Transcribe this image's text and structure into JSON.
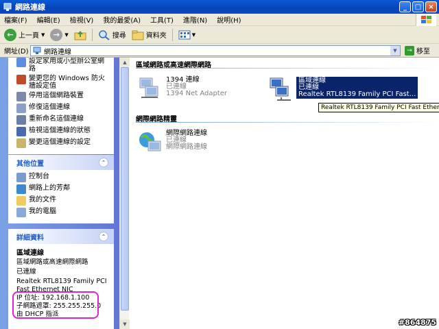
{
  "window": {
    "title": "網路連線"
  },
  "menu": [
    "檔案(F)",
    "編輯(E)",
    "檢視(V)",
    "我的最愛(A)",
    "工具(T)",
    "進階(N)",
    "說明(H)"
  ],
  "toolbar": {
    "back_label": "上一頁",
    "search_label": "搜尋",
    "folders_label": "資料夾"
  },
  "address": {
    "label": "網址(D)",
    "value": "網路連線",
    "go_label": "移至"
  },
  "tasks": [
    "設定家用或小型辦公室網路",
    "變更您的 Windows 防火牆設定值",
    "停用這個網路裝置",
    "修復這個連線",
    "重新命名這個連線",
    "檢視這個連線的狀態",
    "變更這個連線的設定"
  ],
  "other_places": {
    "title": "其他位置",
    "items": [
      "控制台",
      "網路上的芳鄰",
      "我的文件",
      "我的電腦"
    ]
  },
  "details": {
    "title": "詳細資料",
    "name": "區域連線",
    "type": "區域網路或高速網際網路",
    "status": "已連線",
    "adapter": "Realtek RTL8139 Family PCI Fast Ethernet NIC",
    "ip": "IP 位址: 192.168.1.100",
    "mask": "子網路遮罩: 255.255.255.0",
    "dhcp": "由 DHCP 指派"
  },
  "groups": {
    "lan_title": "區域網路或高速網際網路",
    "wizard_title": "網際網路精靈"
  },
  "connections": {
    "c1394": {
      "name": "1394 連線",
      "status": "已連線",
      "device": "1394 Net Adapter"
    },
    "lan": {
      "name": "區域連線",
      "status": "已連線",
      "device": "Realtek RTL8139 Family PCI Fast..."
    },
    "wizard": {
      "name": "網際網路連線",
      "status": "已連線",
      "device": "網際網路連線"
    }
  },
  "tooltip": "Realtek RTL8139 Family PCI Fast Ethernet NIC",
  "watermark": "#864875"
}
